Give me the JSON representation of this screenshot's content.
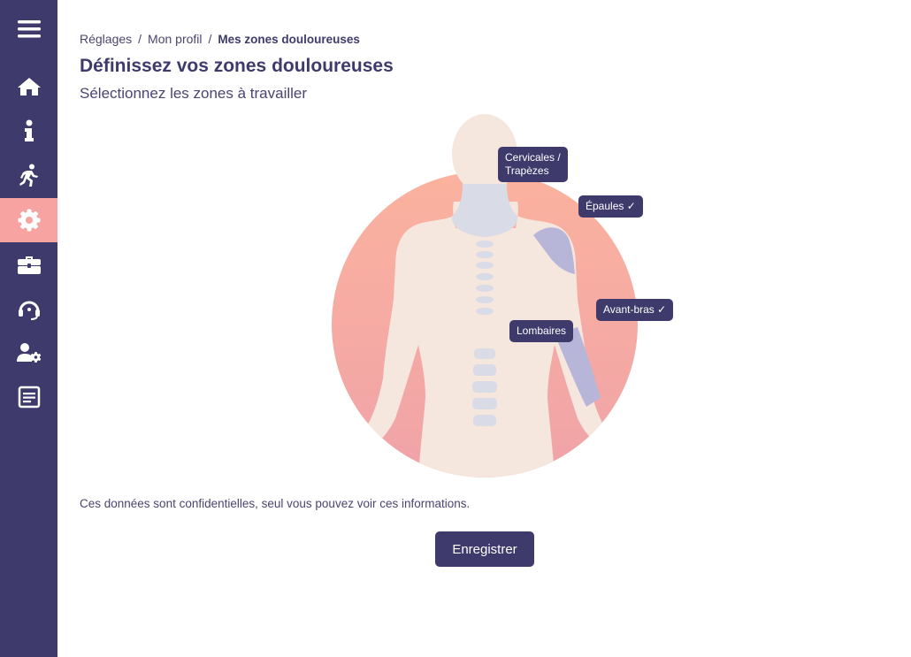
{
  "sidebar": {
    "items": [
      {
        "name": "menu",
        "icon": "menu-icon"
      },
      {
        "name": "home",
        "icon": "home-icon"
      },
      {
        "name": "info",
        "icon": "info-icon"
      },
      {
        "name": "activity",
        "icon": "running-icon"
      },
      {
        "name": "settings",
        "icon": "gear-icon",
        "active": true
      },
      {
        "name": "briefcase",
        "icon": "briefcase-icon"
      },
      {
        "name": "support",
        "icon": "headset-icon"
      },
      {
        "name": "user-settings",
        "icon": "user-gear-icon"
      },
      {
        "name": "document",
        "icon": "document-icon"
      }
    ]
  },
  "breadcrumb": {
    "items": [
      "Réglages",
      "Mon profil",
      "Mes zones douloureuses"
    ],
    "separator": "/"
  },
  "page": {
    "title": "Définissez vos zones douloureuses",
    "subtitle": "Sélectionnez les zones à travailler",
    "note": "Ces données sont confidentielles, seul vous pouvez voir ces informations.",
    "save_label": "Enregistrer"
  },
  "zones": {
    "cervicales": {
      "line1": "Cervicales /",
      "line2": "Trapèzes",
      "selected": false
    },
    "epaules": {
      "label": "Épaules ✓",
      "selected": true
    },
    "avant_bras": {
      "label": "Avant-bras ✓",
      "selected": true
    },
    "lombaires": {
      "label": "Lombaires",
      "selected": false
    }
  },
  "colors": {
    "sidebar": "#3e3a6b",
    "active": "#f7a3a1",
    "accent": "#3e3a6b",
    "body": "#f5e6de",
    "selected_zone": "#b8b6d8",
    "circle_top": "#fbb29e",
    "circle_bottom": "#f0a3a8"
  }
}
